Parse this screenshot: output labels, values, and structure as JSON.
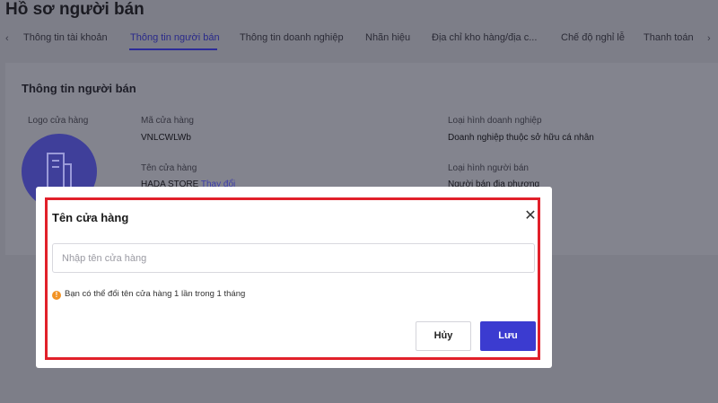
{
  "page": {
    "title": "Hồ sơ người bán"
  },
  "tabs": [
    {
      "label": "Thông tin tài khoản"
    },
    {
      "label": "Thông tin người bán"
    },
    {
      "label": "Thông tin doanh nghiệp"
    },
    {
      "label": "Nhãn hiệu"
    },
    {
      "label": "Địa chỉ kho hàng/địa c..."
    },
    {
      "label": "Chế độ nghỉ lễ"
    },
    {
      "label": "Thanh toán"
    }
  ],
  "active_tab": "Thông tin người bán",
  "seller_info": {
    "title": "Thông tin người bán",
    "logo_label": "Logo cửa hàng",
    "shop_code_label": "Mã cửa hàng",
    "shop_code_value": "VNLCWLWb",
    "shop_name_label": "Tên cửa hàng",
    "shop_name_value": "HADA STORE",
    "change_link": "Thay đổi",
    "business_type_label": "Loại hình doanh nghiệp",
    "business_type_value": "Doanh nghiệp thuộc sở hữu cá nhân",
    "seller_type_label": "Loại hình người bán",
    "seller_type_value": "Người bán địa phương"
  },
  "modal": {
    "title": "Tên cửa hàng",
    "input_placeholder": "Nhập tên cửa hàng",
    "input_value": "",
    "notice": "Bạn có thể đổi tên cửa hàng 1 lần trong 1 tháng",
    "cancel_label": "Hủy",
    "save_label": "Lưu"
  },
  "colors": {
    "accent": "#3b3bd0",
    "highlight_border": "#e1202a",
    "warning": "#f29325",
    "overlay": "#7d7e88"
  },
  "icons": {
    "close": "close-icon",
    "warning": "warning-icon",
    "store_logo": "building-icon"
  }
}
